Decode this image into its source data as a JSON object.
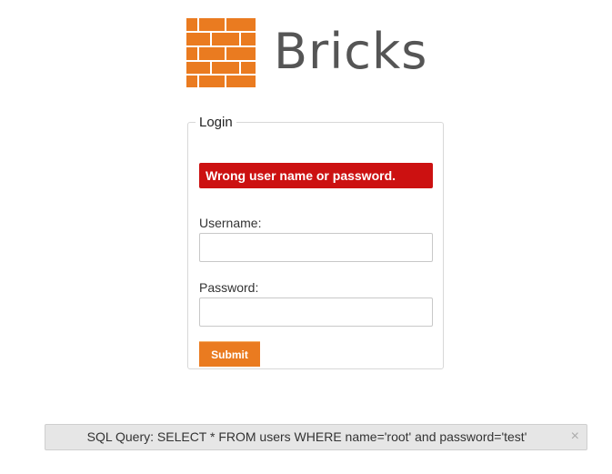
{
  "logo": {
    "brand": "Bricks",
    "mark_color": "#ea7b20",
    "mark_icon": "brick-wall-icon"
  },
  "login": {
    "legend": "Login",
    "error_message": "Wrong user name or password.",
    "error_color": "#cc1111",
    "username_label": "Username:",
    "username_value": "",
    "password_label": "Password:",
    "password_value": "",
    "submit_label": "Submit",
    "submit_color": "#ea7b20"
  },
  "sql_bar": {
    "text": "SQL Query: SELECT * FROM users WHERE name='root' and password='test'",
    "close_symbol": "×"
  }
}
